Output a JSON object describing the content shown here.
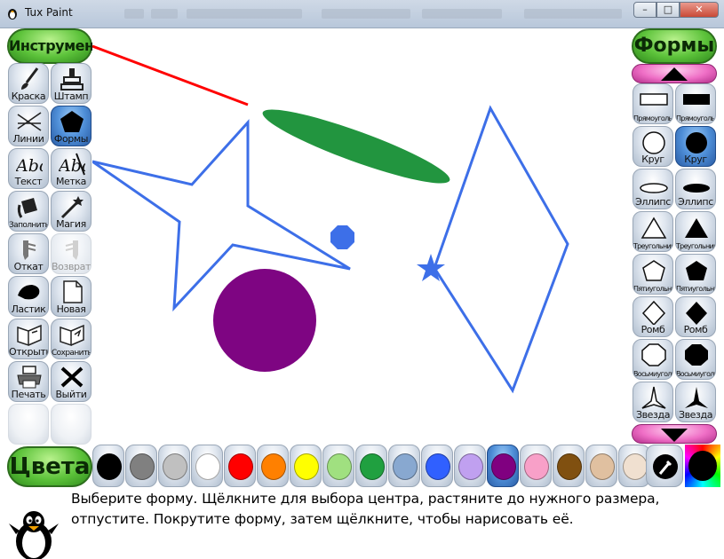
{
  "window": {
    "title": "Tux Paint",
    "minimize_label": "–",
    "maximize_label": "□",
    "close_label": "✕"
  },
  "tools": {
    "header": "Инструменты",
    "items": [
      {
        "label": "Краска",
        "icon": "brush-icon"
      },
      {
        "label": "Штамп",
        "icon": "stamp-icon"
      },
      {
        "label": "Линии",
        "icon": "lines-icon"
      },
      {
        "label": "Формы",
        "icon": "pentagon-icon",
        "selected": true
      },
      {
        "label": "Текст",
        "icon": "text-abc-icon"
      },
      {
        "label": "Метка",
        "icon": "label-abc-icon"
      },
      {
        "label": "Заполнить",
        "icon": "fill-bucket-icon"
      },
      {
        "label": "Магия",
        "icon": "magic-wand-icon"
      },
      {
        "label": "Откат",
        "icon": "undo-icon"
      },
      {
        "label": "Возврат",
        "icon": "redo-icon",
        "disabled": true
      },
      {
        "label": "Ластик",
        "icon": "eraser-icon"
      },
      {
        "label": "Новая",
        "icon": "new-page-icon"
      },
      {
        "label": "Открыть",
        "icon": "open-icon"
      },
      {
        "label": "Сохранить",
        "icon": "save-icon"
      },
      {
        "label": "Печать",
        "icon": "print-icon"
      },
      {
        "label": "Выйти",
        "icon": "quit-icon"
      }
    ]
  },
  "shapes": {
    "header": "Формы",
    "items": [
      {
        "label": "Прямоугольник",
        "icon": "rectangle-outline-icon"
      },
      {
        "label": "Прямоугольник",
        "icon": "rectangle-filled-icon"
      },
      {
        "label": "Круг",
        "icon": "circle-outline-icon"
      },
      {
        "label": "Круг",
        "icon": "circle-filled-icon",
        "selected": true
      },
      {
        "label": "Эллипс",
        "icon": "ellipse-outline-icon"
      },
      {
        "label": "Эллипс",
        "icon": "ellipse-filled-icon"
      },
      {
        "label": "Треугольник",
        "icon": "triangle-outline-icon"
      },
      {
        "label": "Треугольник",
        "icon": "triangle-filled-icon"
      },
      {
        "label": "Пятиугольник",
        "icon": "pentagon-outline-icon"
      },
      {
        "label": "Пятиугольник",
        "icon": "pentagon-filled-icon"
      },
      {
        "label": "Ромб",
        "icon": "rhombus-outline-icon"
      },
      {
        "label": "Ромб",
        "icon": "rhombus-filled-icon"
      },
      {
        "label": "Восьмиугольник",
        "icon": "octagon-outline-icon"
      },
      {
        "label": "Восьмиугольник",
        "icon": "octagon-filled-icon"
      },
      {
        "label": "Звезда",
        "icon": "star-outline-icon"
      },
      {
        "label": "Звезда",
        "icon": "star-filled-icon"
      }
    ]
  },
  "colors": {
    "header": "Цвета",
    "swatches": [
      "#000000",
      "#808080",
      "#c0c0c0",
      "#ffffff",
      "#ff0000",
      "#ff8000",
      "#ffff00",
      "#a0e080",
      "#20a040",
      "#88a8d0",
      "#3060ff",
      "#c0a0f0",
      "#800080",
      "#f8a0c8",
      "#805010",
      "#e0c0a0",
      "#f0e0d0"
    ],
    "selected_index": 12
  },
  "canvas": {
    "line_color": "#ff0000",
    "ellipse_color": "#22953f",
    "outline_color": "#3d6fe8",
    "octagon_color": "#3d6fe8",
    "circle_color": "#7e0582",
    "star_color": "#3d6fe8"
  },
  "status": {
    "message": "Выберите форму. Щёлкните для выбора центра, растяните до нужного размера, отпустите. Покрутите форму, затем щёлкните, чтобы нарисовать её."
  }
}
